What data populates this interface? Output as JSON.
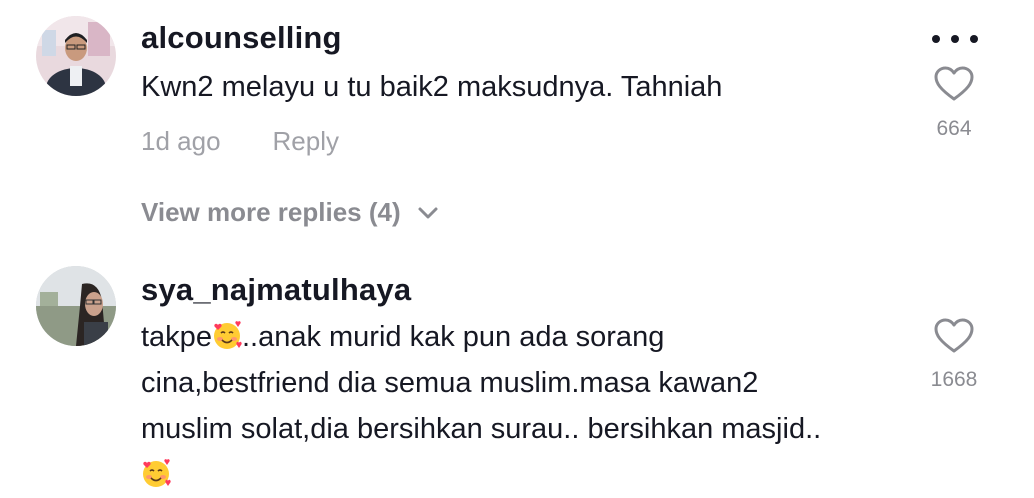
{
  "comments": [
    {
      "username": "alcounselling",
      "text": "Kwn2 melayu u tu baik2 maksudnya. Tahniah",
      "time": "1d ago",
      "reply_label": "Reply",
      "likes": "664",
      "more_icon": "ellipsis-icon",
      "like_icon": "heart-outline-icon"
    },
    {
      "username": "sya_najmatulhaya",
      "text_parts": {
        "part1": "takpe",
        "part2": "..anak murid kak pun ada sorang",
        "line2": "cina,bestfriend dia semua muslim.masa kawan2",
        "line3": "muslim solat,dia bersihkan surau.. bersihkan masjid.."
      },
      "likes": "1668",
      "like_icon": "heart-outline-icon",
      "emoji_icon": "smiling-face-with-hearts-icon"
    }
  ],
  "view_more": {
    "label": "View more replies (4)",
    "icon": "chevron-down-icon"
  },
  "colors": {
    "primary_text": "#161823",
    "secondary_text": "#a0a1a7",
    "muted_text": "#8a8b91"
  }
}
